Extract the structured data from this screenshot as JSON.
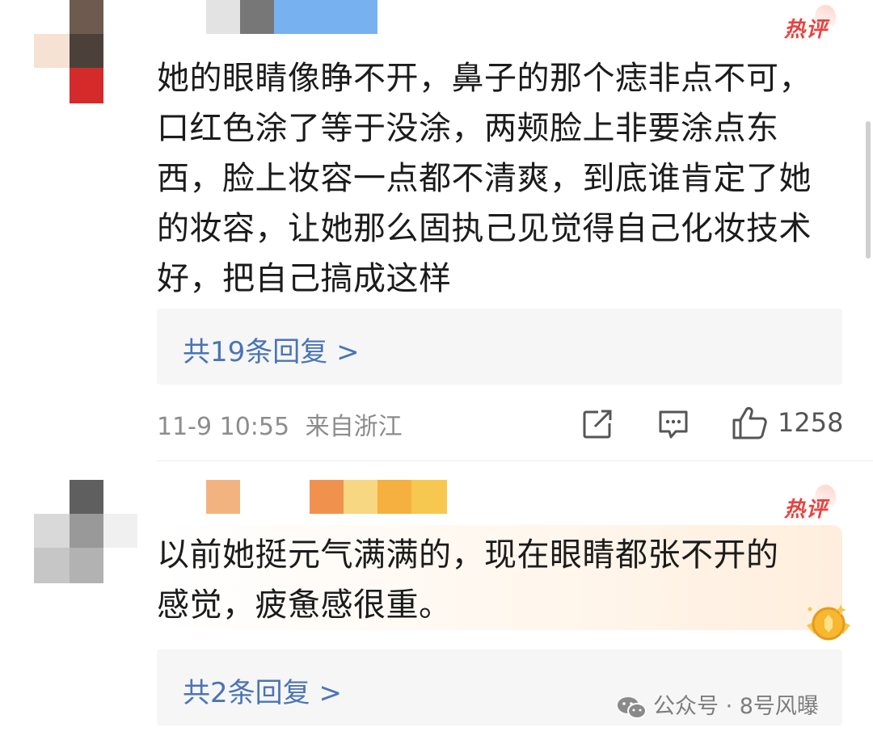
{
  "comments": [
    {
      "badge": "热评",
      "text_lines": [
        "她的眼睛像睁不开，鼻子的那个痣非点不可，",
        "口红色涂了等于没涂，两颊脸上非要涂点东",
        "西，脸上妆容一点都不清爽，到底谁肯定了她",
        "的妆容，让她那么固执己见觉得自己化妆技术",
        "好，把自己搞成这样"
      ],
      "replies": "共19条回复 >",
      "time": "11-9 10:55",
      "location": "来自浙江",
      "likes": "1258"
    },
    {
      "badge": "热评",
      "text_lines": [
        "以前她挺元气满满的，现在眼睛都张不开的",
        "感觉，疲惫感很重。"
      ],
      "replies": "共2条回复 >"
    }
  ],
  "watermark": "公众号 · 8号风曝",
  "icons": [
    "share-icon",
    "comment-icon",
    "like-thumb-icon",
    "wechat-icon",
    "medal-badge-icon"
  ],
  "colors": {
    "accent_link": "#4a74b5",
    "badge_red": "#e8423f"
  }
}
